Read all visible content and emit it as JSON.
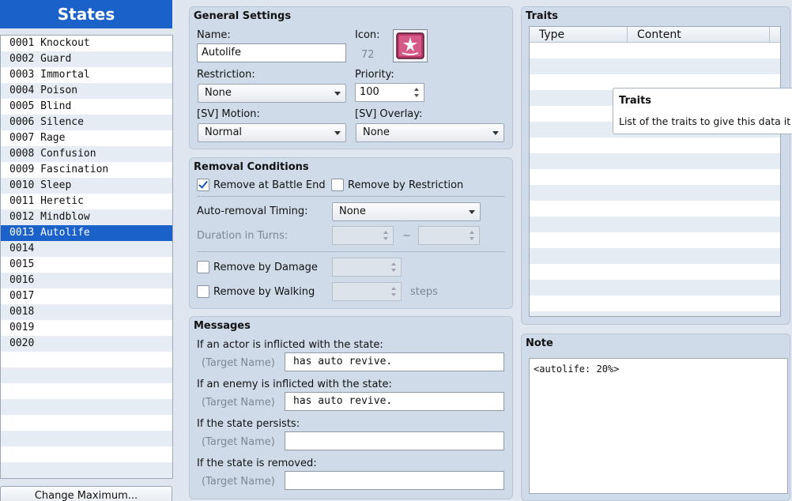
{
  "left": {
    "header": "States",
    "items": [
      {
        "id": "0001",
        "name": "Knockout"
      },
      {
        "id": "0002",
        "name": "Guard"
      },
      {
        "id": "0003",
        "name": "Immortal"
      },
      {
        "id": "0004",
        "name": "Poison"
      },
      {
        "id": "0005",
        "name": "Blind"
      },
      {
        "id": "0006",
        "name": "Silence"
      },
      {
        "id": "0007",
        "name": "Rage"
      },
      {
        "id": "0008",
        "name": "Confusion"
      },
      {
        "id": "0009",
        "name": "Fascination"
      },
      {
        "id": "0010",
        "name": "Sleep"
      },
      {
        "id": "0011",
        "name": "Heretic"
      },
      {
        "id": "0012",
        "name": "Mindblow"
      },
      {
        "id": "0013",
        "name": "Autolife"
      },
      {
        "id": "0014",
        "name": ""
      },
      {
        "id": "0015",
        "name": ""
      },
      {
        "id": "0016",
        "name": ""
      },
      {
        "id": "0017",
        "name": ""
      },
      {
        "id": "0018",
        "name": ""
      },
      {
        "id": "0019",
        "name": ""
      },
      {
        "id": "0020",
        "name": ""
      }
    ],
    "selected_index": 12,
    "change_max_button": "Change Maximum..."
  },
  "general": {
    "title": "General Settings",
    "name_label": "Name:",
    "name_value": "Autolife",
    "icon_label": "Icon:",
    "icon_index": "72",
    "restriction_label": "Restriction:",
    "restriction_value": "None",
    "priority_label": "Priority:",
    "priority_value": "100",
    "sv_motion_label": "[SV] Motion:",
    "sv_motion_value": "Normal",
    "sv_overlay_label": "[SV] Overlay:",
    "sv_overlay_value": "None"
  },
  "removal": {
    "title": "Removal Conditions",
    "remove_battle_end": "Remove at Battle End",
    "remove_battle_end_checked": true,
    "remove_restriction": "Remove by Restriction",
    "remove_restriction_checked": false,
    "auto_timing_label": "Auto-removal Timing:",
    "auto_timing_value": "None",
    "duration_label": "Duration in Turns:",
    "tilde": "~",
    "remove_damage": "Remove by Damage",
    "remove_walking": "Remove by Walking",
    "steps": "steps"
  },
  "messages": {
    "title": "Messages",
    "actor_label": "If an actor is inflicted with the state:",
    "enemy_label": "If an enemy is inflicted with the state:",
    "persist_label": "If the state persists:",
    "removed_label": "If the state is removed:",
    "target_name": "(Target Name)",
    "actor_value": "has auto revive.",
    "enemy_value": "has auto revive.",
    "persist_value": "",
    "removed_value": ""
  },
  "traits": {
    "title": "Traits",
    "col_type": "Type",
    "col_content": "Content",
    "tooltip_title": "Traits",
    "tooltip_text": "List of the traits to give this data it"
  },
  "note": {
    "title": "Note",
    "value": "<autolife: 20%>"
  },
  "colors": {
    "accent": "#1a61c9",
    "panel": "#cfdbe9",
    "icon_bg": "#b83a6a"
  }
}
